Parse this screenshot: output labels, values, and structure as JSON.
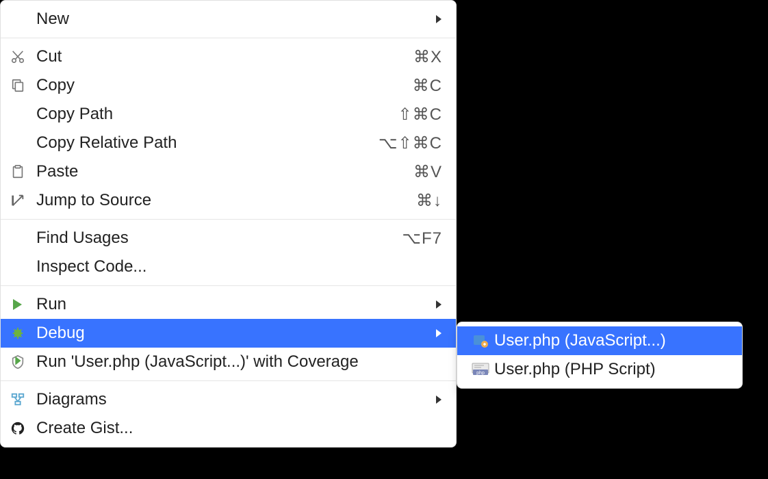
{
  "menu": {
    "items": [
      {
        "label": "New",
        "icon": null,
        "shortcut": "",
        "submenu": true
      },
      {
        "separator": true
      },
      {
        "label": "Cut",
        "icon": "cut",
        "shortcut": "⌘X"
      },
      {
        "label": "Copy",
        "icon": "copy",
        "shortcut": "⌘C"
      },
      {
        "label": "Copy Path",
        "icon": null,
        "shortcut": "⇧⌘C"
      },
      {
        "label": "Copy Relative Path",
        "icon": null,
        "shortcut": "⌥⇧⌘C"
      },
      {
        "label": "Paste",
        "icon": "paste",
        "shortcut": "⌘V"
      },
      {
        "label": "Jump to Source",
        "icon": "jump",
        "shortcut": "⌘↓"
      },
      {
        "separator": true
      },
      {
        "label": "Find Usages",
        "icon": null,
        "shortcut": "⌥F7"
      },
      {
        "label": "Inspect Code...",
        "icon": null,
        "shortcut": ""
      },
      {
        "separator": true
      },
      {
        "label": "Run",
        "icon": "run",
        "shortcut": "",
        "submenu": true
      },
      {
        "label": "Debug",
        "icon": "debug",
        "shortcut": "",
        "submenu": true,
        "highlighted": true
      },
      {
        "label": "Run 'User.php (JavaScript...)' with Coverage",
        "icon": "coverage",
        "shortcut": ""
      },
      {
        "separator": true
      },
      {
        "label": "Diagrams",
        "icon": "diagrams",
        "shortcut": "",
        "submenu": true
      },
      {
        "label": "Create Gist...",
        "icon": "github",
        "shortcut": ""
      }
    ]
  },
  "submenu": {
    "items": [
      {
        "label": "User.php (JavaScript...)",
        "icon": "js-debug",
        "highlighted": true
      },
      {
        "label": "User.php (PHP Script)",
        "icon": "php"
      }
    ]
  }
}
